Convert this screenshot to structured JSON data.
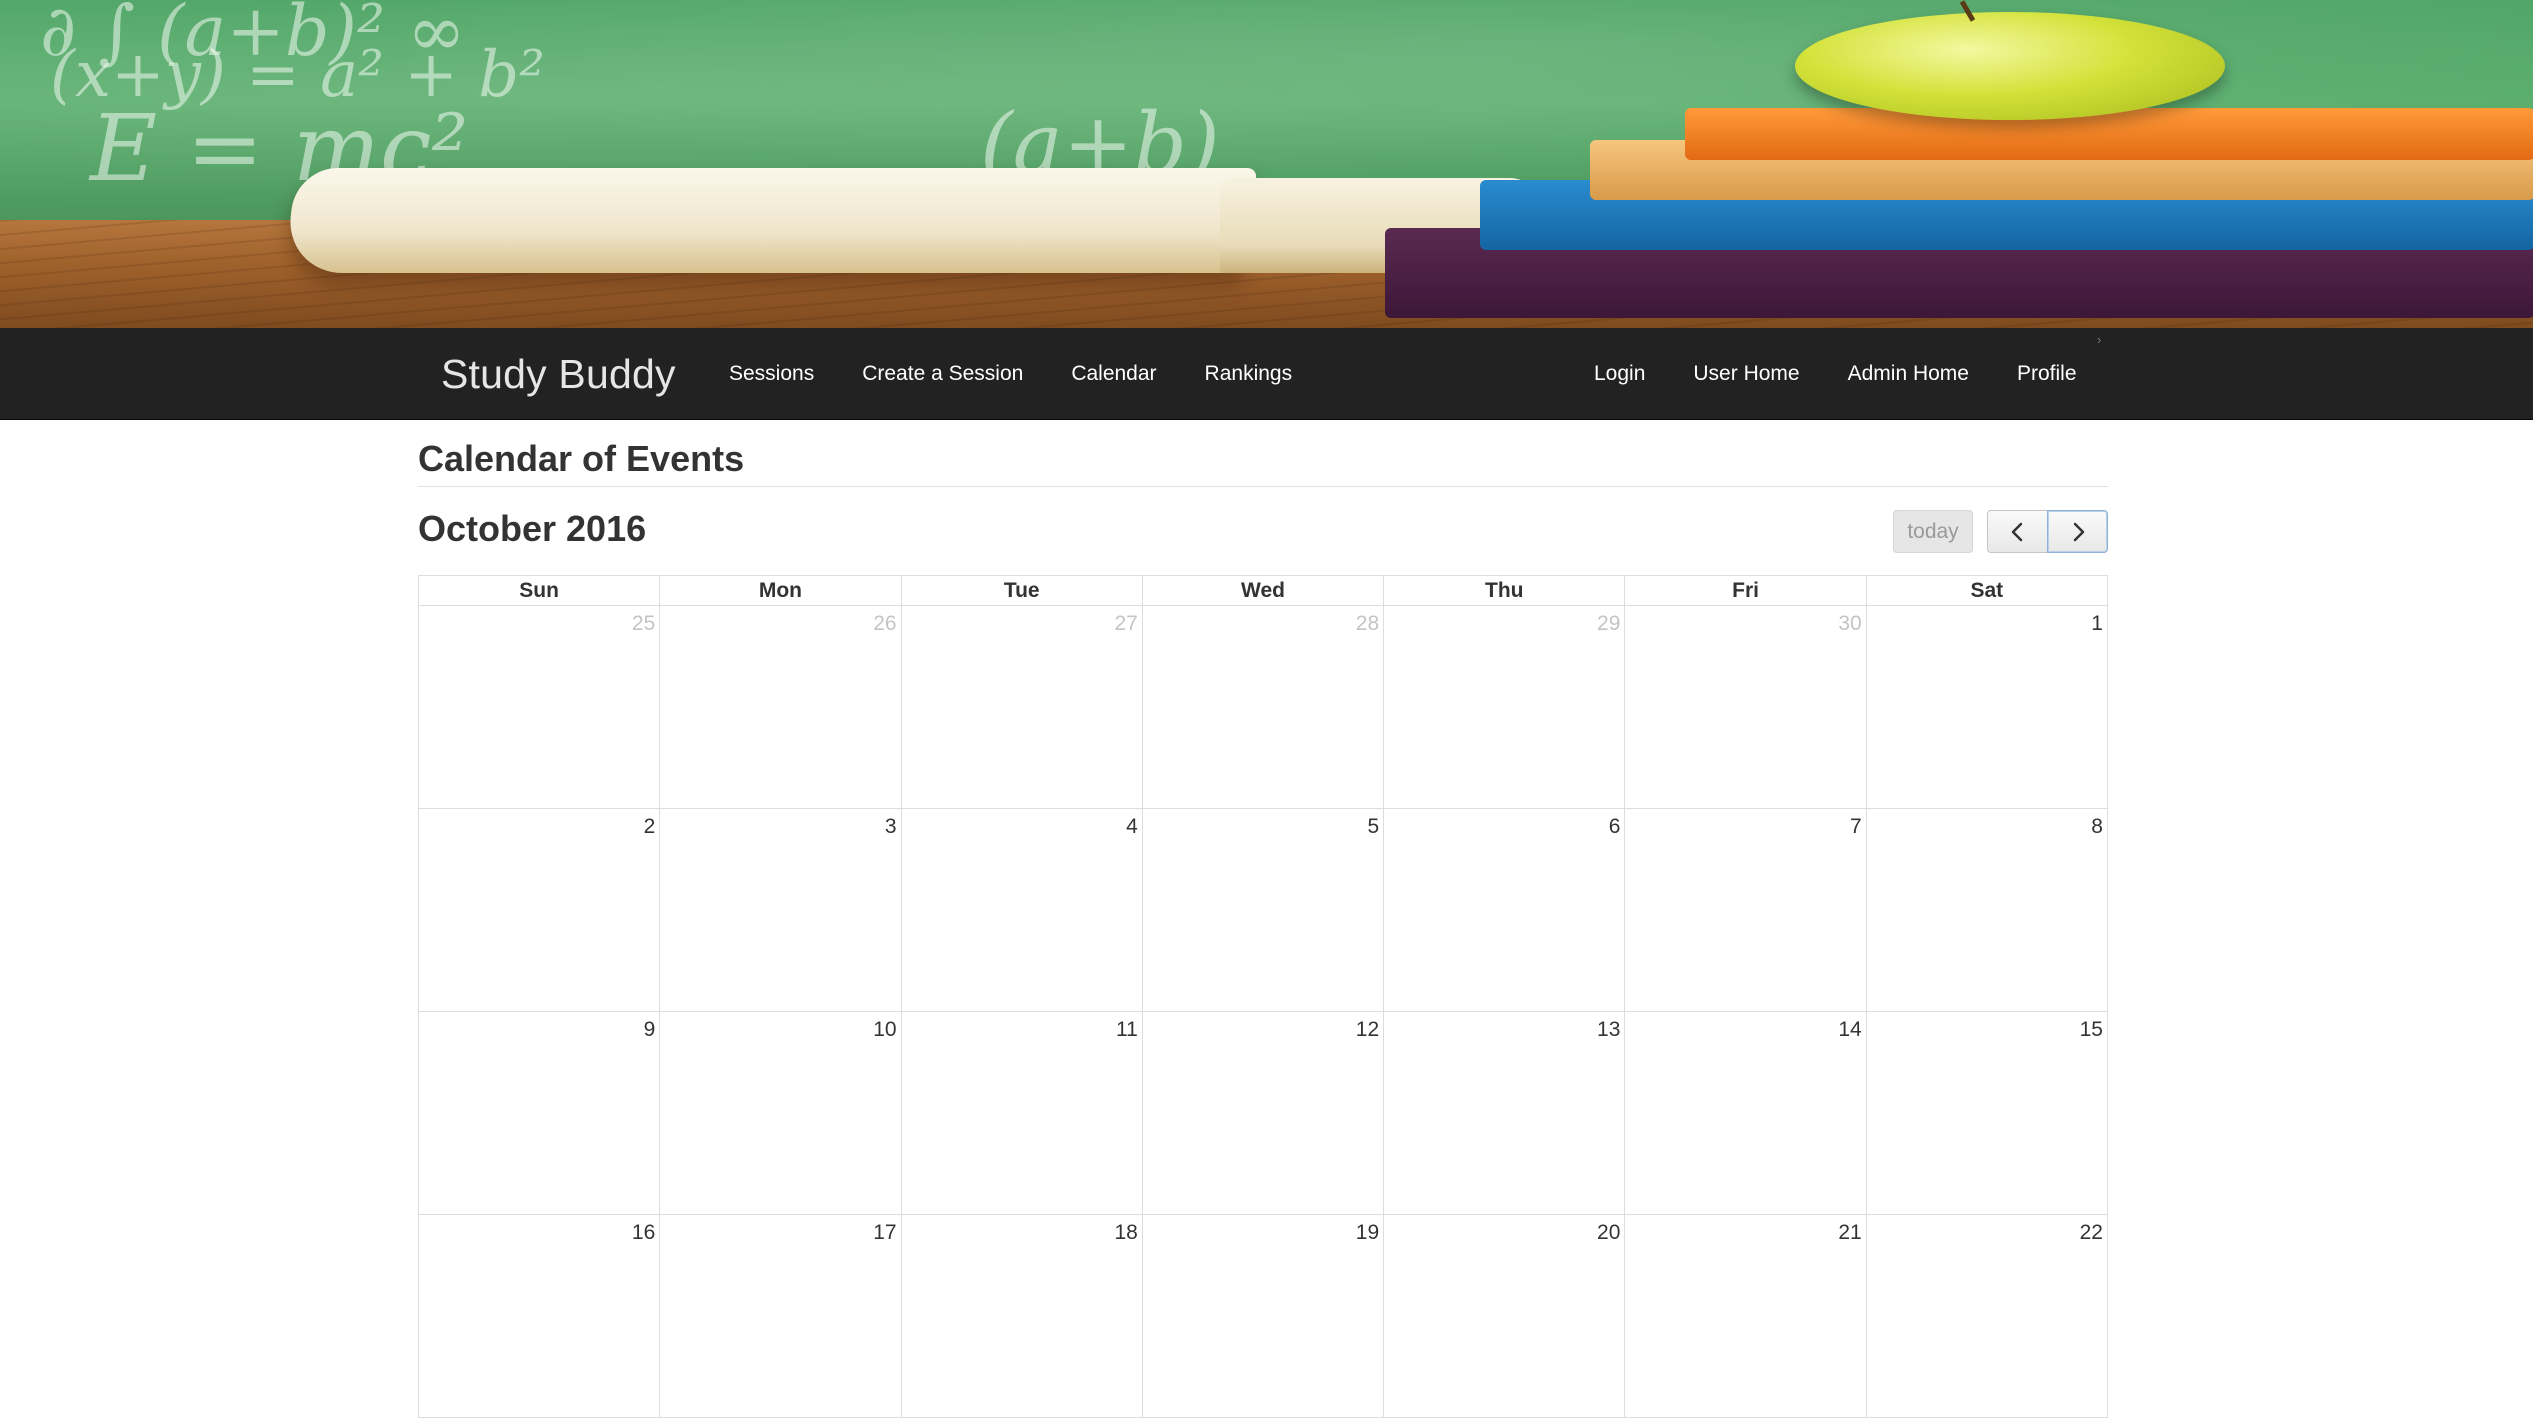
{
  "brand": "Study Buddy",
  "nav_left": [
    "Sessions",
    "Create a Session",
    "Calendar",
    "Rankings"
  ],
  "nav_right": [
    "Login",
    "User Home",
    "Admin Home",
    "Profile"
  ],
  "page_title": "Calendar of Events",
  "calendar": {
    "month_title": "October 2016",
    "today_label": "today",
    "weekdays": [
      "Sun",
      "Mon",
      "Tue",
      "Wed",
      "Thu",
      "Fri",
      "Sat"
    ],
    "weeks": [
      [
        {
          "day": "25",
          "other": true
        },
        {
          "day": "26",
          "other": true
        },
        {
          "day": "27",
          "other": true
        },
        {
          "day": "28",
          "other": true
        },
        {
          "day": "29",
          "other": true
        },
        {
          "day": "30",
          "other": true
        },
        {
          "day": "1",
          "other": false
        }
      ],
      [
        {
          "day": "2",
          "other": false
        },
        {
          "day": "3",
          "other": false
        },
        {
          "day": "4",
          "other": false
        },
        {
          "day": "5",
          "other": false
        },
        {
          "day": "6",
          "other": false
        },
        {
          "day": "7",
          "other": false
        },
        {
          "day": "8",
          "other": false
        }
      ],
      [
        {
          "day": "9",
          "other": false
        },
        {
          "day": "10",
          "other": false
        },
        {
          "day": "11",
          "other": false
        },
        {
          "day": "12",
          "other": false
        },
        {
          "day": "13",
          "other": false
        },
        {
          "day": "14",
          "other": false
        },
        {
          "day": "15",
          "other": false
        }
      ],
      [
        {
          "day": "16",
          "other": false
        },
        {
          "day": "17",
          "other": false
        },
        {
          "day": "18",
          "other": false
        },
        {
          "day": "19",
          "other": false
        },
        {
          "day": "20",
          "other": false
        },
        {
          "day": "21",
          "other": false
        },
        {
          "day": "22",
          "other": false
        }
      ]
    ]
  },
  "icons": {
    "prev": "chevron-left-icon",
    "next": "chevron-right-icon"
  }
}
